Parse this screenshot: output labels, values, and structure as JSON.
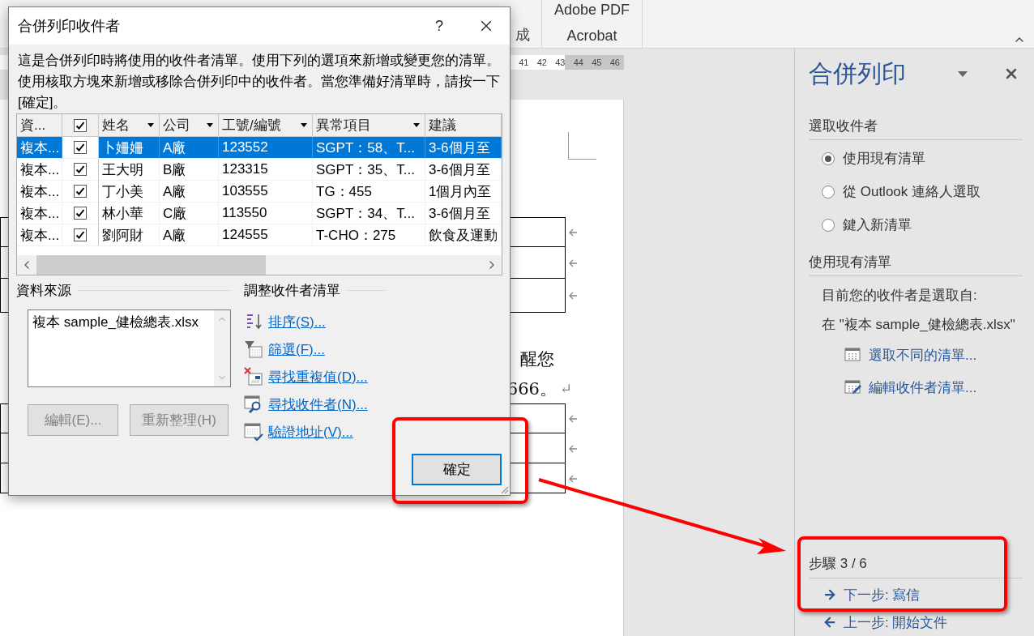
{
  "ribbon": {
    "cut_label": "成",
    "group_lines": [
      "Adobe PDF",
      "Acrobat"
    ]
  },
  "ruler": {
    "marks": [
      "41",
      "42",
      "43",
      "44",
      "45",
      "46"
    ]
  },
  "document": {
    "lines": [
      "醒您",
      "666。"
    ],
    "paragraph_mark": "↵"
  },
  "dialog": {
    "title": "合併列印收件者",
    "help": "?",
    "description": "這是合併列印時將使用的收件者清單。使用下列的選項來新增或變更您的清單。使用核取方塊來新增或移除合併列印中的收件者。當您準備好清單時，請按一下 [確定]。",
    "recipients": {
      "header_checked": true,
      "columns": [
        {
          "label": "資...",
          "filter": false
        },
        {
          "label": "姓名",
          "filter": true
        },
        {
          "label": "公司",
          "filter": true
        },
        {
          "label": "工號/編號",
          "filter": true
        },
        {
          "label": "異常項目",
          "filter": true
        },
        {
          "label": "建議",
          "filter": false
        }
      ],
      "rows": [
        {
          "selected": true,
          "checked": true,
          "cells": [
            "複本...",
            "卜姍姍",
            "A廠",
            "123552",
            "SGPT：58、T...",
            "3-6個月至"
          ]
        },
        {
          "selected": false,
          "checked": true,
          "cells": [
            "複本...",
            "王大明",
            "B廠",
            "123315",
            "SGPT：35、T...",
            "3-6個月至"
          ]
        },
        {
          "selected": false,
          "checked": true,
          "cells": [
            "複本...",
            "丁小美",
            "A廠",
            "103555",
            "TG：455",
            "1個月內至"
          ]
        },
        {
          "selected": false,
          "checked": true,
          "cells": [
            "複本...",
            "林小華",
            "C廠",
            "113550",
            "SGPT：34、T...",
            "3-6個月至"
          ]
        },
        {
          "selected": false,
          "checked": true,
          "cells": [
            "複本...",
            "劉阿財",
            "A廠",
            "124555",
            "T-CHO：275",
            "飲食及運動"
          ]
        }
      ]
    },
    "data_source": {
      "heading": "資料來源",
      "files": [
        "複本 sample_健檢總表.xlsx"
      ],
      "buttons": [
        {
          "label": "編輯(E)...",
          "disabled": true
        },
        {
          "label": "重新整理(H)",
          "disabled": true
        }
      ]
    },
    "refine": {
      "heading": "調整收件者清單",
      "links": [
        {
          "kind": "sort",
          "label": "排序(S)..."
        },
        {
          "kind": "filter",
          "label": "篩選(F)..."
        },
        {
          "kind": "duplicates",
          "label": "尋找重複值(D)..."
        },
        {
          "kind": "find",
          "label": "尋找收件者(N)..."
        },
        {
          "kind": "validate",
          "label": "驗證地址(V)..."
        }
      ]
    },
    "ok_button": "確定"
  },
  "task_pane": {
    "title": "合併列印",
    "section_1": "選取收件者",
    "source_options": [
      {
        "label": "使用現有清單",
        "selected": true
      },
      {
        "label": "從 Outlook 連絡人選取",
        "selected": false
      },
      {
        "label": "鍵入新清單",
        "selected": false
      }
    ],
    "section_2": "使用現有清單",
    "info": "目前您的收件者是選取自:",
    "source_file": "在 \"複本 sample_健檢總表.xlsx\"",
    "actions": [
      {
        "kind": "select",
        "label": "選取不同的清單..."
      },
      {
        "kind": "edit",
        "label": "編輯收件者清單..."
      }
    ],
    "step": "步驟 3 / 6",
    "nav": [
      {
        "kind": "next",
        "label": "下一步: 寫信"
      },
      {
        "kind": "back",
        "label": "上一步: 開始文件"
      }
    ]
  }
}
